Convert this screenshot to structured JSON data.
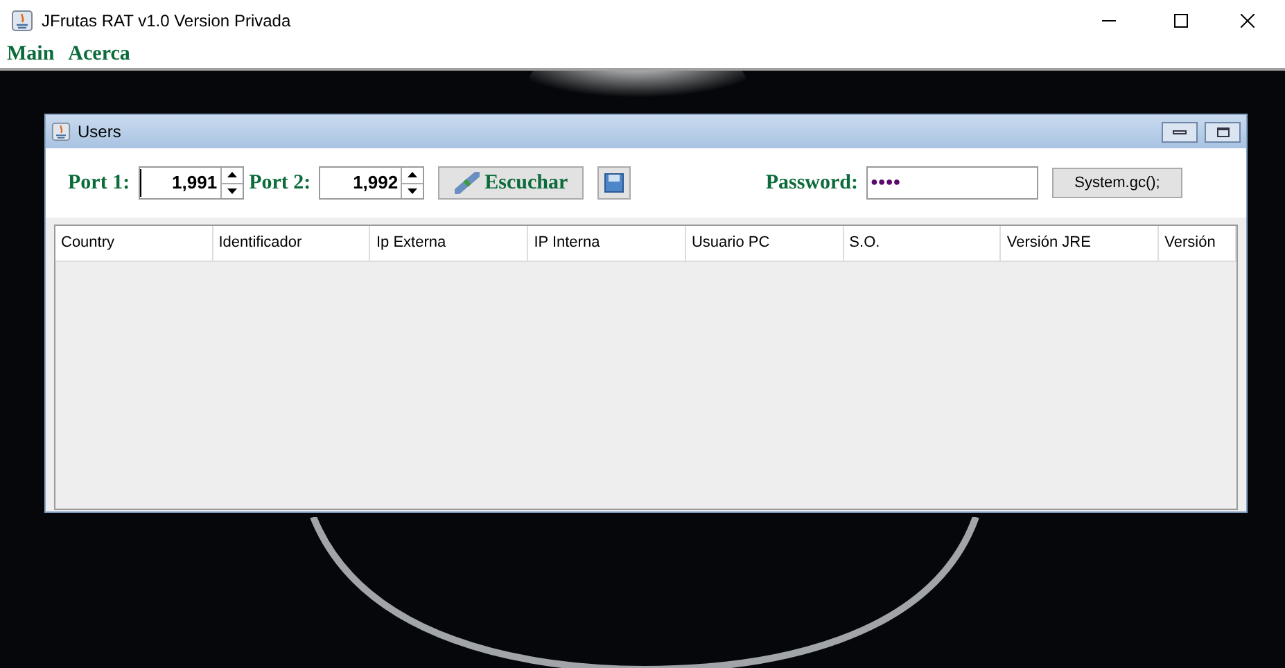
{
  "window": {
    "title": "JFrutas RAT v1.0 Version Privada"
  },
  "menu": [
    "Main",
    "Acerca"
  ],
  "frame": {
    "title": "Users"
  },
  "toolbar": {
    "port1": {
      "label": "Port 1:",
      "value": "1,991"
    },
    "port2": {
      "label": "Port 2:",
      "value": "1,992"
    },
    "listen_button": "Escuchar",
    "password": {
      "label": "Password:",
      "value": "●●●●"
    },
    "gc_button": "System.gc();"
  },
  "table": {
    "columns": [
      "Country",
      "Identificador",
      "Ip Externa",
      "IP Interna",
      "Usuario PC",
      "S.O.",
      "Versión JRE",
      "Versión"
    ]
  }
}
